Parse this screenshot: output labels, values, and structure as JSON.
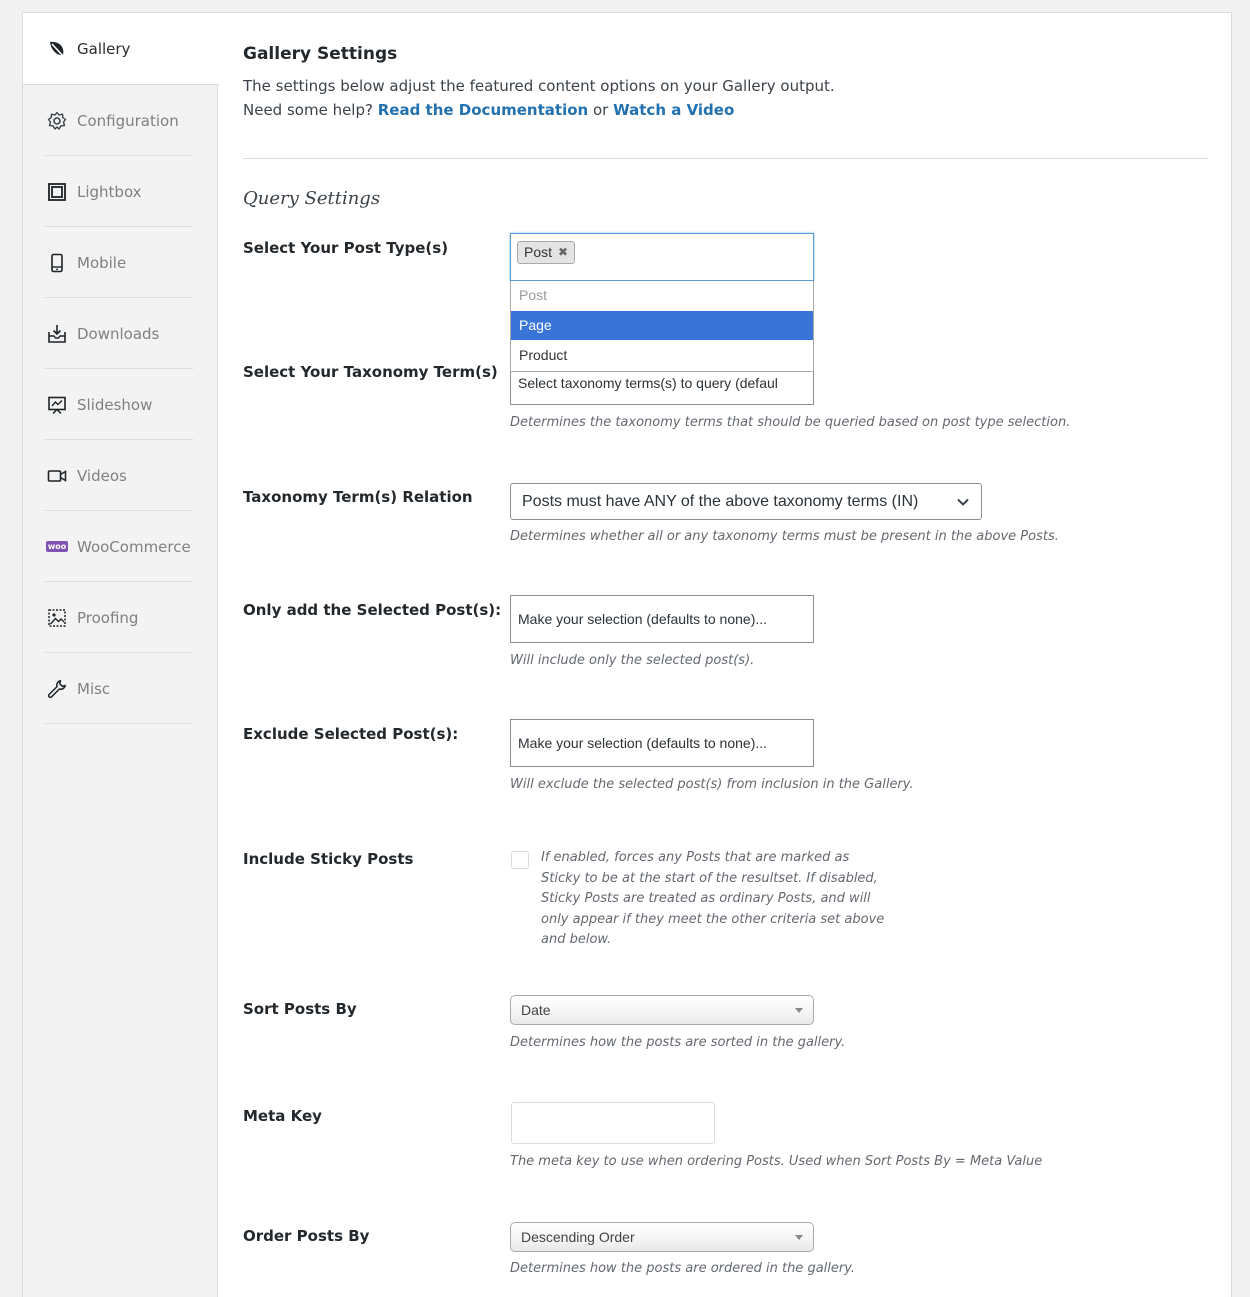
{
  "sidebar": {
    "items": [
      {
        "label": "Gallery",
        "icon": "leaf-icon"
      },
      {
        "label": "Configuration",
        "icon": "gear-icon"
      },
      {
        "label": "Lightbox",
        "icon": "lightbox-icon"
      },
      {
        "label": "Mobile",
        "icon": "mobile-icon"
      },
      {
        "label": "Downloads",
        "icon": "download-icon"
      },
      {
        "label": "Slideshow",
        "icon": "slideshow-icon"
      },
      {
        "label": "Videos",
        "icon": "video-camera-icon"
      },
      {
        "label": "WooCommerce",
        "icon": "woo-icon",
        "badge": "woo"
      },
      {
        "label": "Proofing",
        "icon": "image-icon"
      },
      {
        "label": "Misc",
        "icon": "wrench-icon"
      }
    ]
  },
  "header": {
    "title": "Gallery Settings",
    "description": "The settings below adjust the featured content options on your Gallery output.",
    "help_prefix": "Need some help?",
    "help_doc_link": "Read the Documentation",
    "help_or": "or",
    "help_video_link": "Watch a Video"
  },
  "section": {
    "title": "Query Settings"
  },
  "post_type": {
    "label": "Select Your Post Type(s)",
    "selected_token": "Post",
    "remove_glyph": "✖",
    "options": [
      "Post",
      "Page",
      "Product"
    ]
  },
  "taxonomy_terms": {
    "label": "Select Your Taxonomy Term(s)",
    "placeholder": "Select taxonomy terms(s) to query (defaul",
    "hint": "Determines the taxonomy terms that should be queried based on post type selection."
  },
  "relation": {
    "label": "Taxonomy Term(s) Relation",
    "value": "Posts must have ANY of the above taxonomy terms (IN)",
    "hint": "Determines whether all or any taxonomy terms must be present in the above Posts."
  },
  "include_posts": {
    "label": "Only add the Selected Post(s):",
    "placeholder": "Make your selection (defaults to none)...",
    "hint": "Will include only the selected post(s)."
  },
  "exclude_posts": {
    "label": "Exclude Selected Post(s):",
    "placeholder": "Make your selection (defaults to none)...",
    "hint": "Will exclude the selected post(s) from inclusion in the Gallery."
  },
  "sticky": {
    "label": "Include Sticky Posts",
    "description": "If enabled, forces any Posts that are marked as Sticky to be at the start of the resultset. If disabled, Sticky Posts are treated as ordinary Posts, and will only appear if they meet the other criteria set above and below."
  },
  "sort_by": {
    "label": "Sort Posts By",
    "value": "Date",
    "hint": "Determines how the posts are sorted in the gallery."
  },
  "meta_key": {
    "label": "Meta Key",
    "value": "",
    "hint": "The meta key to use when ordering Posts. Used when Sort Posts By = Meta Value"
  },
  "order_by": {
    "label": "Order Posts By",
    "value": "Descending Order",
    "hint": "Determines how the posts are ordered in the gallery."
  },
  "colors": {
    "link": "#2271b1",
    "highlight": "#3875d7",
    "sidebar_bg": "#f3f3f3"
  }
}
